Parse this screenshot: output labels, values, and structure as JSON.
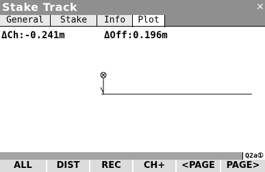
{
  "window": {
    "title": "Stake Track",
    "close_glyph": "×"
  },
  "tabs": [
    {
      "label": "General"
    },
    {
      "label": "Stake"
    },
    {
      "label": "Info"
    },
    {
      "label": "Plot",
      "active": true
    }
  ],
  "readout": {
    "delta_ch": "ΔCh:-0.241m",
    "delta_off": "ΔOff:0.196m"
  },
  "status": {
    "badge": "Q2a①"
  },
  "softkeys": [
    "ALL",
    "DIST",
    "REC",
    "CH+",
    "<PAGE",
    "PAGE>"
  ],
  "colors": {
    "titlebar": "#8f8f8f",
    "softkey_bg": "#dcdcdc",
    "status_bar": "#a3a3a3"
  },
  "plot": {
    "target_marker": "target-crosshair-icon"
  }
}
